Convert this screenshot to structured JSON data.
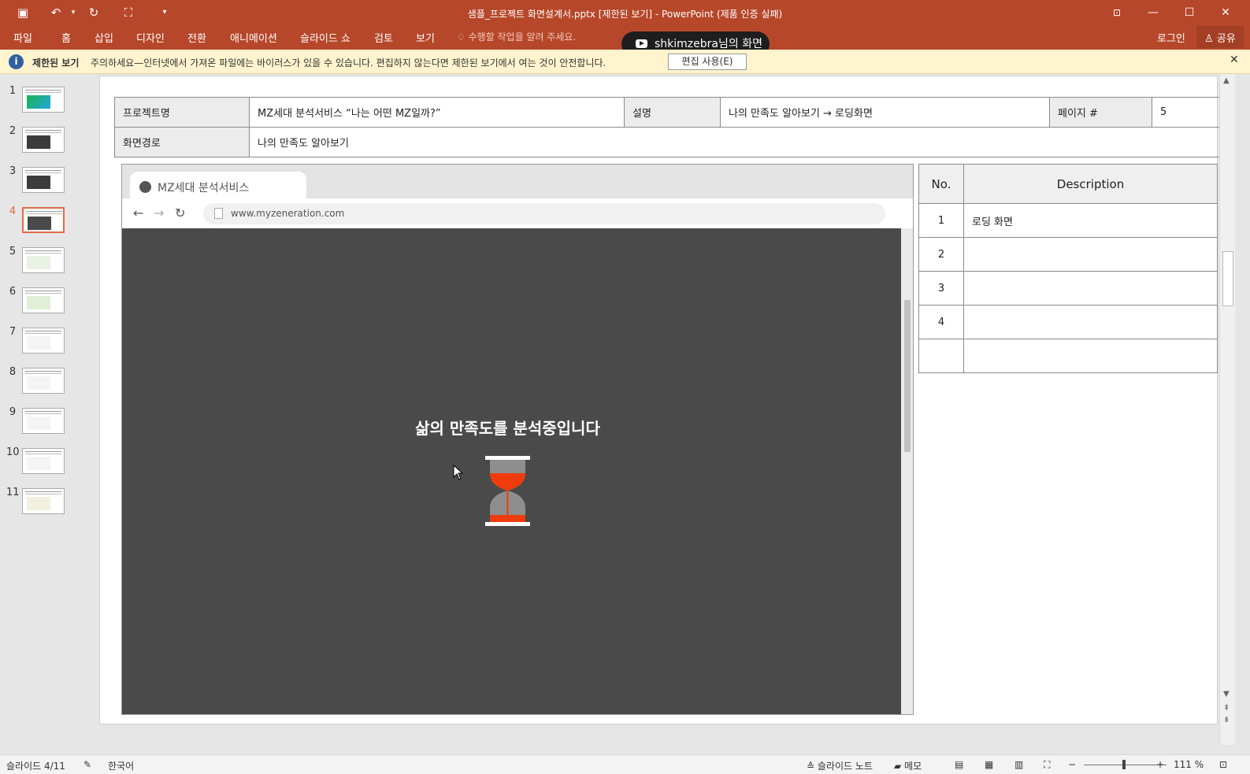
{
  "window": {
    "title": "샘플_프로젝트 화면설계서.pptx [제한된 보기] - PowerPoint (제품 인증 실패)"
  },
  "ribbon": {
    "tabs": [
      "파일",
      "홈",
      "삽입",
      "디자인",
      "전환",
      "애니메이션",
      "슬라이드 쇼",
      "검토",
      "보기"
    ],
    "tell_me": "수행할 작업을 알려 주세요.",
    "login": "로그인",
    "share": "공유"
  },
  "screen_share": {
    "label": "shkimzebra님의 화면"
  },
  "protected_view": {
    "title": "제한된 보기",
    "message": "주의하세요—인터넷에서 가져온 파일에는 바이러스가 있을 수 있습니다. 편집하지 않는다면 제한된 보기에서 여는 것이 안전합니다.",
    "enable_button": "편집 사용(E)"
  },
  "thumbnails": {
    "numbers": [
      "1",
      "2",
      "3",
      "4",
      "5",
      "6",
      "7",
      "8",
      "9",
      "10",
      "11"
    ],
    "active_index": 4
  },
  "slide": {
    "header": {
      "project_label": "프로젝트명",
      "project_value": "MZ세대 분석서비스 “나는 어떤 MZ일까?”",
      "desc_label": "설명",
      "desc_value": "나의 만족도 알아보기 → 로딩화면",
      "page_label": "페이지 #",
      "page_value": "5",
      "path_label": "화면경로",
      "path_value": "나의 만족도 알아보기"
    },
    "browser": {
      "tab_title": "MZ세대 분석서비스",
      "url": "www.myzeneration.com",
      "loading_text": "삶의 만족도를 분석중입니다"
    },
    "desc_table": {
      "headers": [
        "No.",
        "Description"
      ],
      "rows": [
        [
          "1",
          "로딩 화면"
        ],
        [
          "2",
          ""
        ],
        [
          "3",
          ""
        ],
        [
          "4",
          ""
        ],
        [
          "",
          ""
        ]
      ]
    }
  },
  "status": {
    "slide_indicator": "슬라이드 4/11",
    "language": "한국어",
    "notes": "슬라이드 노트",
    "comments": "메모",
    "zoom": "111 %"
  },
  "colors": {
    "accent": "#b7472a",
    "hourglass_red": "#f03c0c",
    "hourglass_gray": "#8e8e8e"
  }
}
